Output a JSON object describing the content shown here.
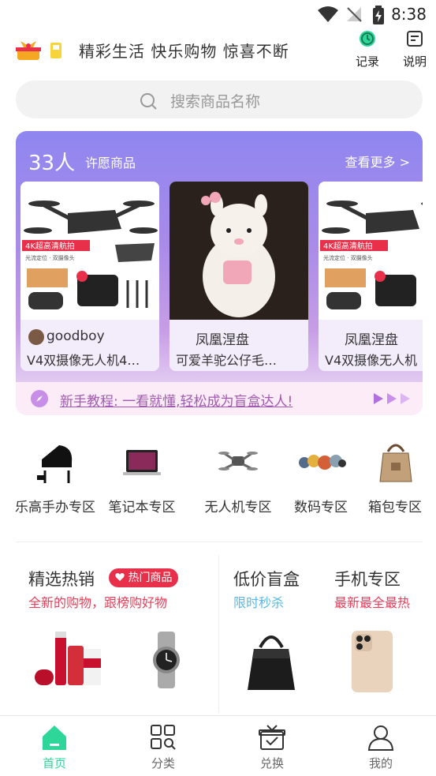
{
  "status_bar": {
    "time": "8:38"
  },
  "header": {
    "slogan": "精彩生活 快乐购物 惊喜不断",
    "record_label": "记录",
    "help_label": "说明"
  },
  "search": {
    "placeholder": "搜索商品名称"
  },
  "wish": {
    "count": "33人",
    "tag": "许愿商品",
    "more": "查看更多 >",
    "cards": [
      {
        "name": "goodboy",
        "title": "V4双摄像无人机4…"
      },
      {
        "name": "凤凰涅盘",
        "title": "可爱羊驼公仔毛…"
      },
      {
        "name": "凤凰涅盘",
        "title": "V4双摄像无人机"
      }
    ],
    "drone_badge": "4K超高清航拍",
    "drone_sub": "光流定位 · 双摄像头",
    "tutorial": "新手教程: 一看就懂,轻松成为盲盒达人!"
  },
  "categories": [
    {
      "label": "乐高手办专区",
      "icon": "piano-icon"
    },
    {
      "label": "笔记本专区",
      "icon": "laptop-icon"
    },
    {
      "label": "无人机专区",
      "icon": "drone-icon"
    },
    {
      "label": "数码专区",
      "icon": "earbuds-icon"
    },
    {
      "label": "箱包专区",
      "icon": "bag-icon"
    }
  ],
  "promos": {
    "hot": {
      "title": "精选热销",
      "badge": "热门商品",
      "sub": "全新的购物，跟榜购好物"
    },
    "cheap": {
      "title": "低价盲盒",
      "sub": "限时秒杀"
    },
    "phone": {
      "title": "手机专区",
      "sub": "最新最全最热"
    }
  },
  "nav": [
    {
      "label": "首页",
      "active": true
    },
    {
      "label": "分类",
      "active": false
    },
    {
      "label": "兑换",
      "active": false
    },
    {
      "label": "我的",
      "active": false
    }
  ],
  "colors": {
    "accent": "#2fd69a",
    "hot_red": "#e8304a",
    "sub_blue": "#5ab8e8",
    "sub_pink": "#e8405a"
  }
}
